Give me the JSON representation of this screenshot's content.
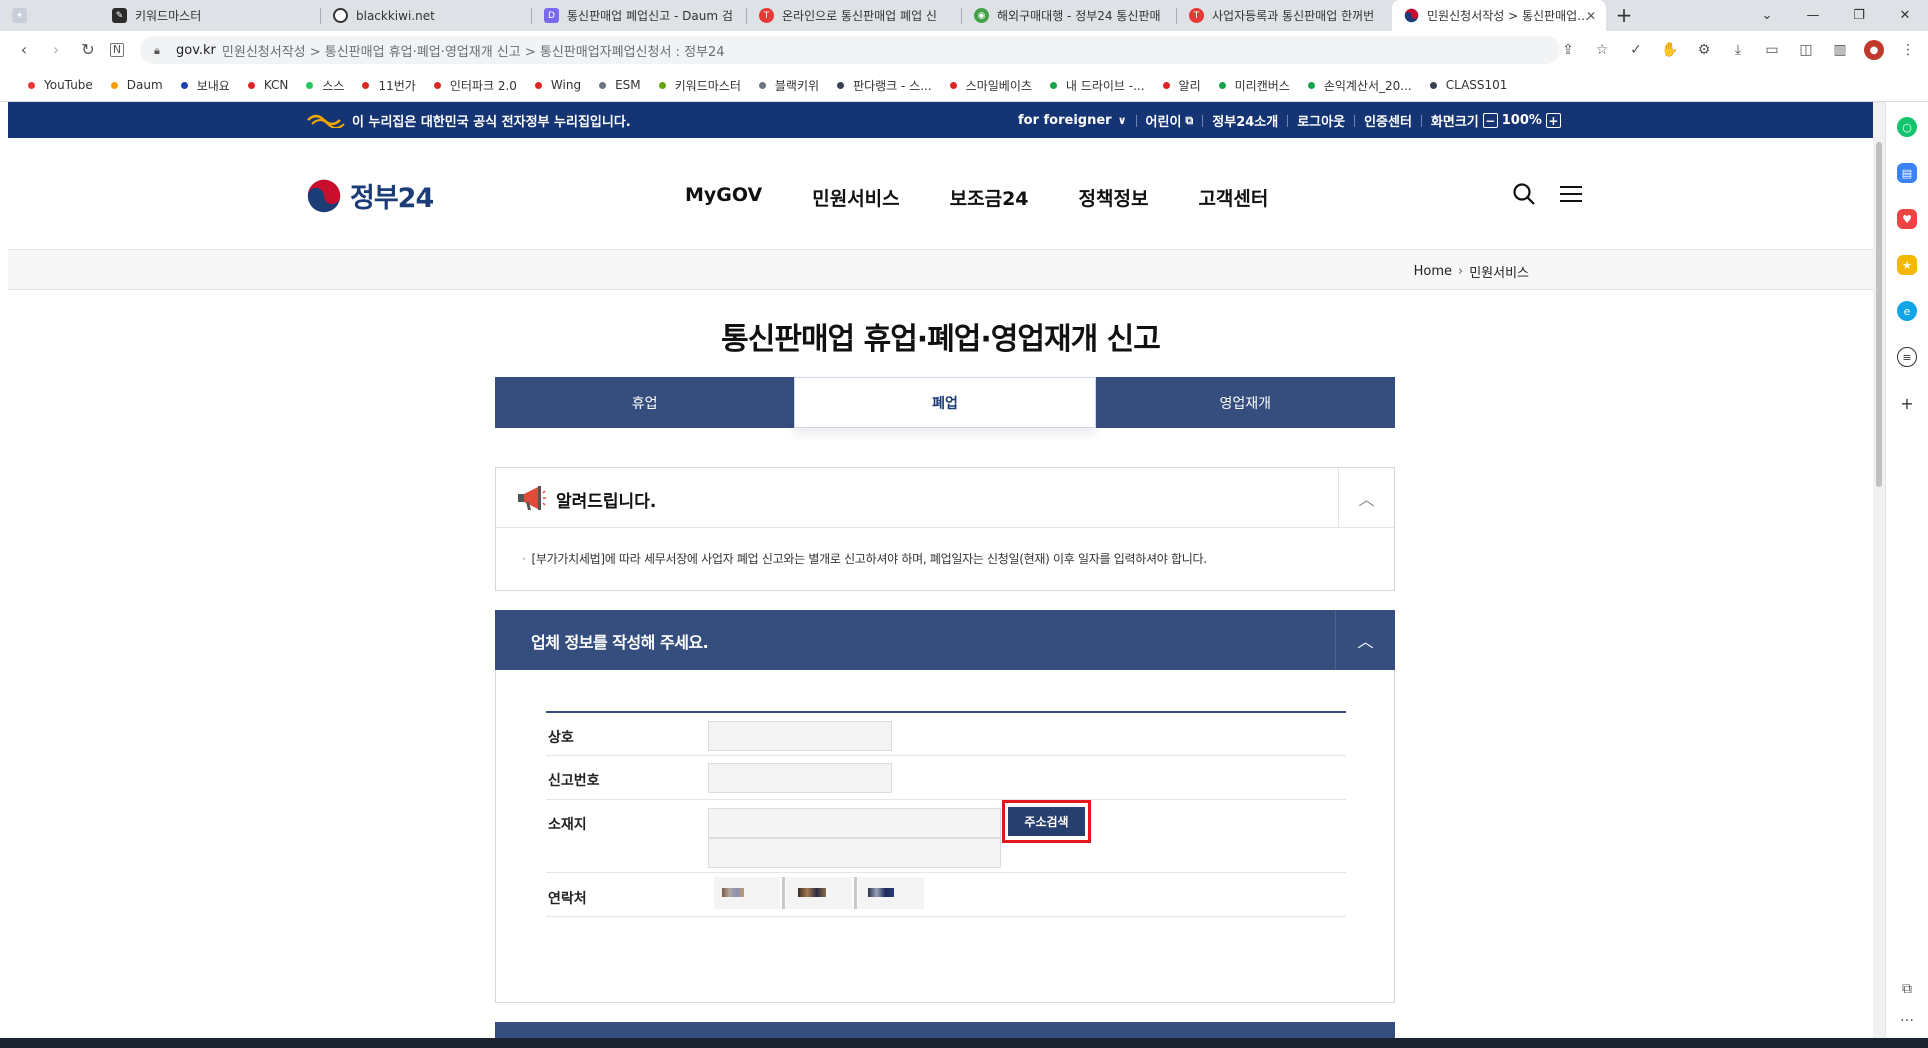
{
  "browser": {
    "tabs": [
      {
        "label": "",
        "favicon_color": "#9aa4b5",
        "active": false
      },
      {
        "label": "키워드마스터",
        "favicon_color": "#2b2b2b",
        "active": false
      },
      {
        "label": "blackkiwi.net",
        "favicon_color": "#333333",
        "active": false
      },
      {
        "label": "통신판매업 폐업신고 - Daum 검",
        "favicon_color": "#7b68ee",
        "active": false
      },
      {
        "label": "온라인으로 통신판매업 폐업 신",
        "favicon_color": "#e53935",
        "active": false
      },
      {
        "label": "해외구매대행 - 정부24 통신판매",
        "favicon_color": "#43a047",
        "active": false
      },
      {
        "label": "사업자등록과 통신판매업 한꺼번",
        "favicon_color": "#e53935",
        "active": false
      },
      {
        "label": "민원신청서작성 > 통신판매업 휴",
        "favicon_color": "#1c3c78",
        "active": true
      }
    ],
    "url_host": "gov.kr",
    "url_path": "민원신청서작성 > 통신판매업 휴업·폐업·영업재개 신고 > 통신판매업자폐업신청서 : 정부24",
    "bookmarks": [
      {
        "label": "YouTube",
        "color": "#e53935"
      },
      {
        "label": "Daum",
        "color": "#f59e0b"
      },
      {
        "label": "보내요",
        "color": "#1e40af"
      },
      {
        "label": "KCN",
        "color": "#dc2626"
      },
      {
        "label": "스스",
        "color": "#22c55e"
      },
      {
        "label": "11번가",
        "color": "#dc2626"
      },
      {
        "label": "인터파크 2.0",
        "color": "#dc2626"
      },
      {
        "label": "Wing",
        "color": "#dc2626"
      },
      {
        "label": "ESM",
        "color": "#6b7280"
      },
      {
        "label": "키워드마스터",
        "color": "#65a30d"
      },
      {
        "label": "블랙키위",
        "color": "#6b7280"
      },
      {
        "label": "판다랭크 - 스...",
        "color": "#374151"
      },
      {
        "label": "스마일베이츠",
        "color": "#dc2626"
      },
      {
        "label": "내 드라이브 -...",
        "color": "#16a34a"
      },
      {
        "label": "알리",
        "color": "#dc2626"
      },
      {
        "label": "미리캔버스",
        "color": "#16a34a"
      },
      {
        "label": "손익계산서_20...",
        "color": "#16a34a"
      },
      {
        "label": "CLASS101",
        "color": "#374151"
      }
    ]
  },
  "gov_banner": {
    "text": "이 누리집은 대한민국 공식 전자정부 누리집입니다.",
    "foreigner": "for foreigner",
    "kids": "어린이",
    "about": "정부24소개",
    "logout": "로그아웃",
    "cert": "인증센터",
    "screen_size": "화면크기",
    "zoom": "100%"
  },
  "header": {
    "logo": "정부24",
    "menu": [
      "MyGOV",
      "민원서비스",
      "보조금24",
      "정책정보",
      "고객센터"
    ]
  },
  "breadcrumb": {
    "home": "Home",
    "current": "민원서비스"
  },
  "page_title": "통신판매업 휴업·폐업·영업재개 신고",
  "tabs": [
    {
      "label": "휴업",
      "active": false
    },
    {
      "label": "폐업",
      "active": true
    },
    {
      "label": "영업재개",
      "active": false
    }
  ],
  "notice": {
    "title": "알려드립니다.",
    "body": "[부가가치세법]에 따라 세무서장에 사업자 폐업 신고와는 별개로 신고하셔야 하며, 폐업일자는 신청일(현재) 이후 일자를 입력하셔야 합니다."
  },
  "form": {
    "title": "업체 정보를 작성해 주세요.",
    "fields": {
      "company": {
        "label": "상호",
        "value": ""
      },
      "report_no": {
        "label": "신고번호",
        "value": ""
      },
      "address": {
        "label": "소재지",
        "value": "",
        "detail": ""
      },
      "contact": {
        "label": "연락처"
      }
    },
    "address_search_button": "주소검색"
  }
}
